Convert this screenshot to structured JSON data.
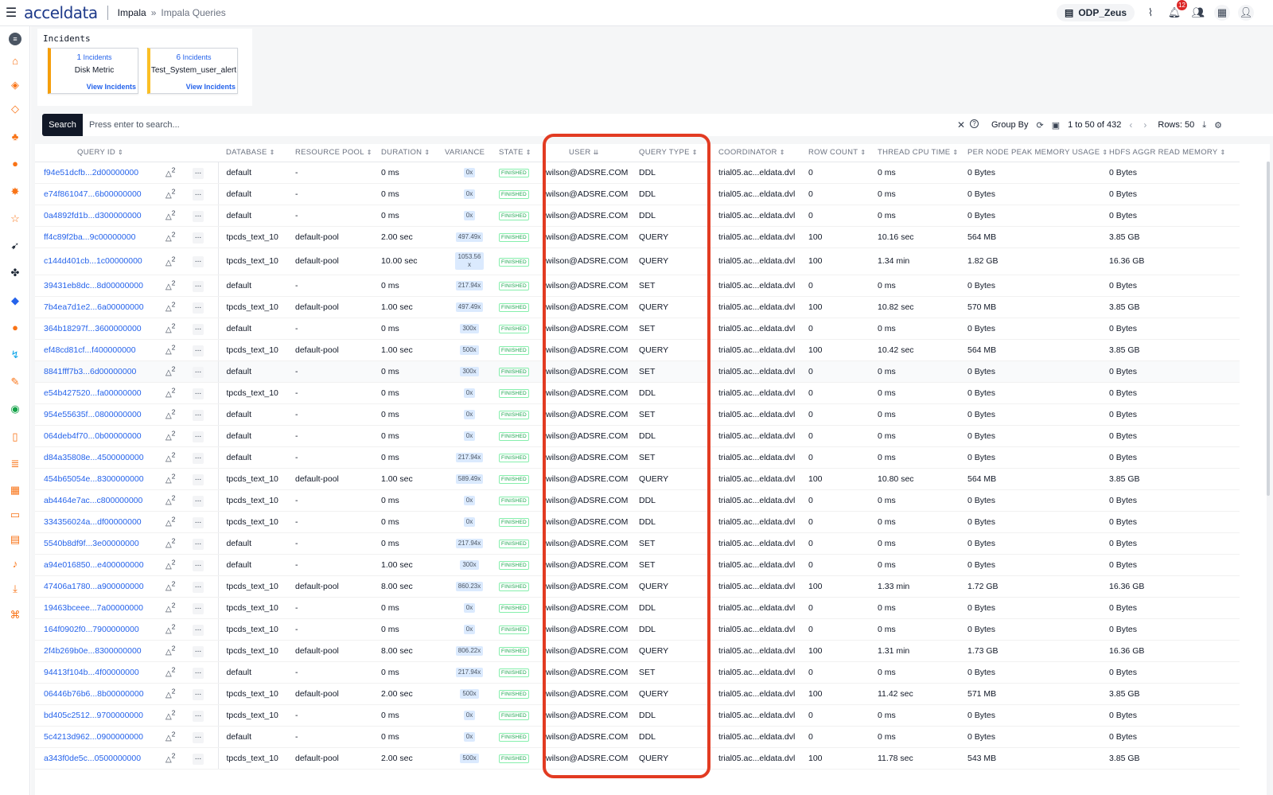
{
  "topbar": {
    "brand": "acceldata",
    "breadcrumb_root": "Impala",
    "breadcrumb_sep": "»",
    "breadcrumb_current": "Impala Queries",
    "cluster_name": "ODP_Zeus",
    "notification_count": "12"
  },
  "incidents": {
    "title": "Incidents",
    "cards": [
      {
        "count": "1",
        "count_label": "Incidents",
        "name": "Disk Metric",
        "link": "View Incidents"
      },
      {
        "count": "6",
        "count_label": "Incidents",
        "name": "Test_System_user_alert",
        "link": "View Incidents"
      }
    ]
  },
  "search": {
    "button": "Search",
    "placeholder": "Press enter to search...",
    "group_by": "Group By",
    "pagination": "1 to 50 of 432",
    "rows": "Rows: 50"
  },
  "table": {
    "headers": [
      "QUERY ID",
      "DATABASE",
      "RESOURCE POOL",
      "DURATION",
      "VARIANCE",
      "STATE",
      "USER",
      "QUERY TYPE",
      "COORDINATOR",
      "ROW COUNT",
      "THREAD CPU TIME",
      "PER NODE PEAK MEMORY USAGE",
      "HDFS AGGR READ MEMORY"
    ],
    "rows": [
      [
        "f94e51dcfb...2d00000000",
        "default",
        "-",
        "0 ms",
        "0x",
        "FINISHED",
        "wilson@ADSRE.COM",
        "DDL",
        "trial05.ac...eldata.dvl",
        "0",
        "0 ms",
        "0 Bytes",
        "0 Bytes"
      ],
      [
        "e74f861047...6b00000000",
        "default",
        "-",
        "0 ms",
        "0x",
        "FINISHED",
        "wilson@ADSRE.COM",
        "DDL",
        "trial05.ac...eldata.dvl",
        "0",
        "0 ms",
        "0 Bytes",
        "0 Bytes"
      ],
      [
        "0a4892fd1b...d300000000",
        "default",
        "-",
        "0 ms",
        "0x",
        "FINISHED",
        "wilson@ADSRE.COM",
        "DDL",
        "trial05.ac...eldata.dvl",
        "0",
        "0 ms",
        "0 Bytes",
        "0 Bytes"
      ],
      [
        "ff4c89f2ba...9c00000000",
        "tpcds_text_10",
        "default-pool",
        "2.00 sec",
        "497.49x",
        "FINISHED",
        "wilson@ADSRE.COM",
        "QUERY",
        "trial05.ac...eldata.dvl",
        "100",
        "10.16 sec",
        "564 MB",
        "3.85 GB"
      ],
      [
        "c144d401cb...1c00000000",
        "tpcds_text_10",
        "default-pool",
        "10.00 sec",
        "1053.56 x",
        "FINISHED",
        "wilson@ADSRE.COM",
        "QUERY",
        "trial05.ac...eldata.dvl",
        "100",
        "1.34 min",
        "1.82 GB",
        "16.36 GB"
      ],
      [
        "39431eb8dc...8d00000000",
        "default",
        "-",
        "0 ms",
        "217.94x",
        "FINISHED",
        "wilson@ADSRE.COM",
        "SET",
        "trial05.ac...eldata.dvl",
        "0",
        "0 ms",
        "0 Bytes",
        "0 Bytes"
      ],
      [
        "7b4ea7d1e2...6a00000000",
        "tpcds_text_10",
        "default-pool",
        "1.00 sec",
        "497.49x",
        "FINISHED",
        "wilson@ADSRE.COM",
        "QUERY",
        "trial05.ac...eldata.dvl",
        "100",
        "10.82 sec",
        "570 MB",
        "3.85 GB"
      ],
      [
        "364b18297f...3600000000",
        "default",
        "-",
        "0 ms",
        "300x",
        "FINISHED",
        "wilson@ADSRE.COM",
        "SET",
        "trial05.ac...eldata.dvl",
        "0",
        "0 ms",
        "0 Bytes",
        "0 Bytes"
      ],
      [
        "ef48cd81cf...f400000000",
        "tpcds_text_10",
        "default-pool",
        "1.00 sec",
        "500x",
        "FINISHED",
        "wilson@ADSRE.COM",
        "QUERY",
        "trial05.ac...eldata.dvl",
        "100",
        "10.42 sec",
        "564 MB",
        "3.85 GB"
      ],
      [
        "8841fff7b3...6d00000000",
        "default",
        "-",
        "0 ms",
        "300x",
        "FINISHED",
        "wilson@ADSRE.COM",
        "SET",
        "trial05.ac...eldata.dvl",
        "0",
        "0 ms",
        "0 Bytes",
        "0 Bytes"
      ],
      [
        "e54b427520...fa00000000",
        "tpcds_text_10",
        "-",
        "0 ms",
        "0x",
        "FINISHED",
        "wilson@ADSRE.COM",
        "DDL",
        "trial05.ac...eldata.dvl",
        "0",
        "0 ms",
        "0 Bytes",
        "0 Bytes"
      ],
      [
        "954e55635f...0800000000",
        "default",
        "-",
        "0 ms",
        "0x",
        "FINISHED",
        "wilson@ADSRE.COM",
        "SET",
        "trial05.ac...eldata.dvl",
        "0",
        "0 ms",
        "0 Bytes",
        "0 Bytes"
      ],
      [
        "064deb4f70...0b00000000",
        "default",
        "-",
        "0 ms",
        "0x",
        "FINISHED",
        "wilson@ADSRE.COM",
        "DDL",
        "trial05.ac...eldata.dvl",
        "0",
        "0 ms",
        "0 Bytes",
        "0 Bytes"
      ],
      [
        "d84a35808e...4500000000",
        "default",
        "-",
        "0 ms",
        "217.94x",
        "FINISHED",
        "wilson@ADSRE.COM",
        "SET",
        "trial05.ac...eldata.dvl",
        "0",
        "0 ms",
        "0 Bytes",
        "0 Bytes"
      ],
      [
        "454b65054e...8300000000",
        "tpcds_text_10",
        "default-pool",
        "1.00 sec",
        "589.49x",
        "FINISHED",
        "wilson@ADSRE.COM",
        "QUERY",
        "trial05.ac...eldata.dvl",
        "100",
        "10.80 sec",
        "564 MB",
        "3.85 GB"
      ],
      [
        "ab4464e7ac...c800000000",
        "tpcds_text_10",
        "-",
        "0 ms",
        "0x",
        "FINISHED",
        "wilson@ADSRE.COM",
        "DDL",
        "trial05.ac...eldata.dvl",
        "0",
        "0 ms",
        "0 Bytes",
        "0 Bytes"
      ],
      [
        "334356024a...df00000000",
        "tpcds_text_10",
        "-",
        "0 ms",
        "0x",
        "FINISHED",
        "wilson@ADSRE.COM",
        "DDL",
        "trial05.ac...eldata.dvl",
        "0",
        "0 ms",
        "0 Bytes",
        "0 Bytes"
      ],
      [
        "5540b8df9f...3e00000000",
        "default",
        "-",
        "0 ms",
        "217.94x",
        "FINISHED",
        "wilson@ADSRE.COM",
        "SET",
        "trial05.ac...eldata.dvl",
        "0",
        "0 ms",
        "0 Bytes",
        "0 Bytes"
      ],
      [
        "a94e016850...e400000000",
        "default",
        "-",
        "1.00 sec",
        "300x",
        "FINISHED",
        "wilson@ADSRE.COM",
        "SET",
        "trial05.ac...eldata.dvl",
        "0",
        "0 ms",
        "0 Bytes",
        "0 Bytes"
      ],
      [
        "47406a1780...a900000000",
        "tpcds_text_10",
        "default-pool",
        "8.00 sec",
        "860.23x",
        "FINISHED",
        "wilson@ADSRE.COM",
        "QUERY",
        "trial05.ac...eldata.dvl",
        "100",
        "1.33 min",
        "1.72 GB",
        "16.36 GB"
      ],
      [
        "19463bceee...7a00000000",
        "tpcds_text_10",
        "-",
        "0 ms",
        "0x",
        "FINISHED",
        "wilson@ADSRE.COM",
        "DDL",
        "trial05.ac...eldata.dvl",
        "0",
        "0 ms",
        "0 Bytes",
        "0 Bytes"
      ],
      [
        "164f0902f0...7900000000",
        "tpcds_text_10",
        "-",
        "0 ms",
        "0x",
        "FINISHED",
        "wilson@ADSRE.COM",
        "DDL",
        "trial05.ac...eldata.dvl",
        "0",
        "0 ms",
        "0 Bytes",
        "0 Bytes"
      ],
      [
        "2f4b269b0e...8300000000",
        "tpcds_text_10",
        "default-pool",
        "8.00 sec",
        "806.22x",
        "FINISHED",
        "wilson@ADSRE.COM",
        "QUERY",
        "trial05.ac...eldata.dvl",
        "100",
        "1.31 min",
        "1.73 GB",
        "16.36 GB"
      ],
      [
        "94413f104b...4f00000000",
        "default",
        "-",
        "0 ms",
        "217.94x",
        "FINISHED",
        "wilson@ADSRE.COM",
        "SET",
        "trial05.ac...eldata.dvl",
        "0",
        "0 ms",
        "0 Bytes",
        "0 Bytes"
      ],
      [
        "06446b76b6...8b00000000",
        "tpcds_text_10",
        "default-pool",
        "2.00 sec",
        "500x",
        "FINISHED",
        "wilson@ADSRE.COM",
        "QUERY",
        "trial05.ac...eldata.dvl",
        "100",
        "11.42 sec",
        "571 MB",
        "3.85 GB"
      ],
      [
        "bd405c2512...9700000000",
        "tpcds_text_10",
        "-",
        "0 ms",
        "0x",
        "FINISHED",
        "wilson@ADSRE.COM",
        "DDL",
        "trial05.ac...eldata.dvl",
        "0",
        "0 ms",
        "0 Bytes",
        "0 Bytes"
      ],
      [
        "5c4213d962...0900000000",
        "default",
        "-",
        "0 ms",
        "0x",
        "FINISHED",
        "wilson@ADSRE.COM",
        "DDL",
        "trial05.ac...eldata.dvl",
        "0",
        "0 ms",
        "0 Bytes",
        "0 Bytes"
      ],
      [
        "a343f0de5c...0500000000",
        "tpcds_text_10",
        "default-pool",
        "2.00 sec",
        "500x",
        "FINISHED",
        "wilson@ADSRE.COM",
        "QUERY",
        "trial05.ac...eldata.dvl",
        "100",
        "11.78 sec",
        "543 MB",
        "3.85 GB"
      ]
    ],
    "alert_count": "2",
    "more_label": "..."
  },
  "colors": {
    "accent_blue": "#2563eb",
    "sidebar_orange": "#f97316",
    "highlight_red": "#e23b22",
    "state_green": "#16a34a"
  }
}
